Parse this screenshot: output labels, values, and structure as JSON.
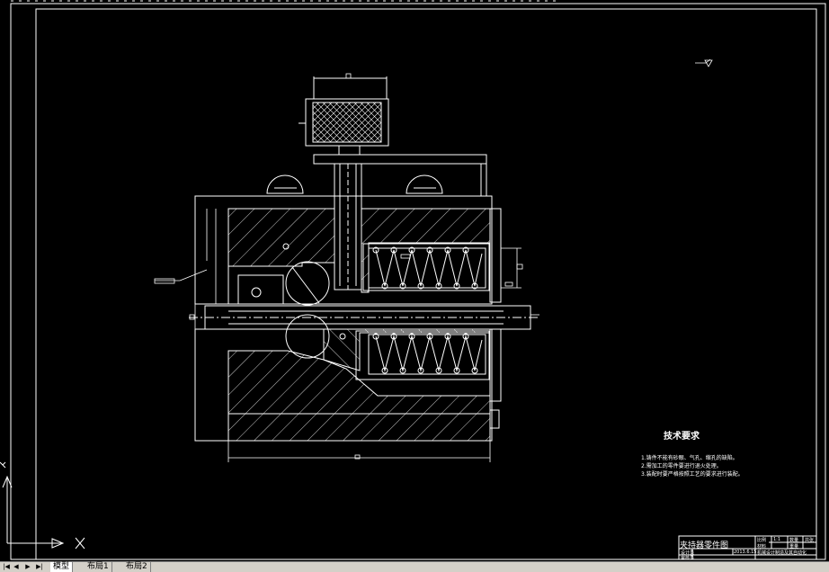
{
  "drawing_notes": {
    "title": "技术要求",
    "items": [
      "1.铸件不能有砂眼、气孔、缩孔的缺陷。",
      "2.需加工的零件要进行退火处理。",
      "3.装配时要严格按照工艺的要求进行装配。"
    ]
  },
  "title_block": {
    "drawing_name": "夹持器零件图",
    "row2_left": "设计员",
    "row2_mid": "2013.6.15",
    "row2_right": "机械设计制造及其自动化",
    "row3_left": "审核员",
    "cells": [
      "比例",
      "1:1",
      "数量",
      "材料",
      "重量",
      "共张"
    ]
  },
  "tabs": {
    "nav_first": "|◀",
    "nav_prev": "◀",
    "nav_next": "▶",
    "nav_last": "▶|",
    "model": "模型",
    "layout1": "布局1",
    "layout2": "布局2"
  },
  "ucs": {
    "x_label": "X",
    "y_label": "Y"
  },
  "colors": {
    "background": "#000000",
    "lines": "#ffffff",
    "tabbar": "#d4d0c8"
  }
}
